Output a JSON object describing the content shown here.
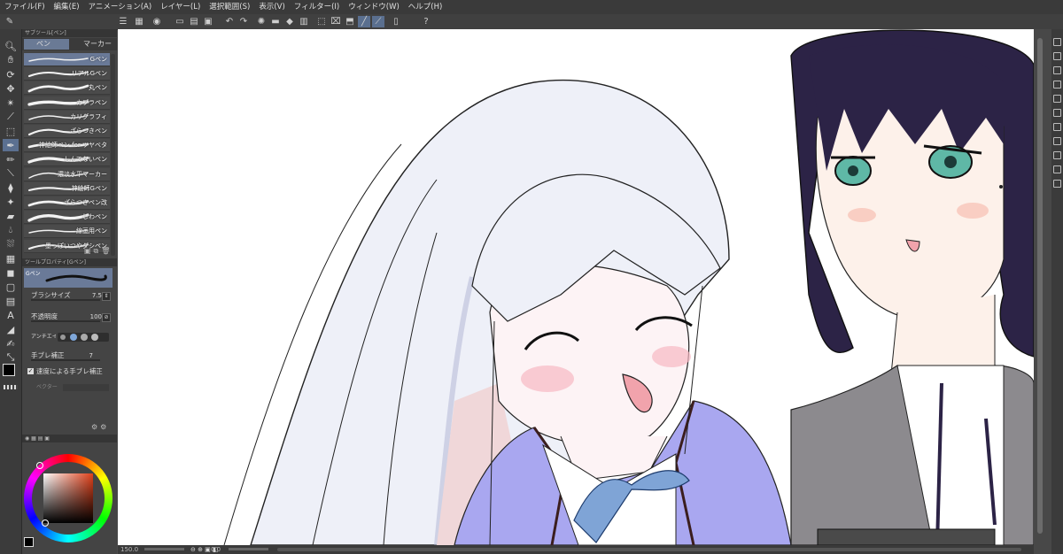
{
  "menu": [
    "ファイル(F)",
    "編集(E)",
    "アニメーション(A)",
    "レイヤー(L)",
    "選択範囲(S)",
    "表示(V)",
    "フィルター(I)",
    "ウィンドウ(W)",
    "ヘルプ(H)"
  ],
  "subtool_panel": {
    "header": "サブツール[ペン]",
    "tabs": [
      "ペン",
      "マーカー"
    ],
    "brushes": [
      "Gペン",
      "リアルGペン",
      "丸ペン",
      "カブラペン",
      "カリグラフィ",
      "ざらつきペン",
      "神絵師ペン for ツヤベタ",
      "しんでないペン",
      "濃淡水平マーカー",
      "神絵師Gペン",
      "ざらつきペン改",
      "じわペン",
      "線画用ペン",
      "墨っぽいつやダシペン"
    ],
    "active_brush_index": 0
  },
  "tool_property": {
    "header": "ツールプロパティ[Gペン]",
    "brush_name": "Gペン",
    "rows": [
      {
        "label": "ブラシサイズ",
        "value": "7.5"
      },
      {
        "label": "不透明度",
        "value": "100"
      },
      {
        "label": "アンチエイリアス",
        "value": ""
      },
      {
        "label": "手ブレ補正",
        "value": "7"
      }
    ],
    "checkbox_label": "速度による手ブレ補正",
    "vector_label": "ベクター"
  },
  "status": {
    "zoom": "150.0",
    "angle": "0.0"
  },
  "colors": {
    "accent": "#5b7090",
    "main_color": "#000000",
    "sub_color": "#ffffff"
  }
}
